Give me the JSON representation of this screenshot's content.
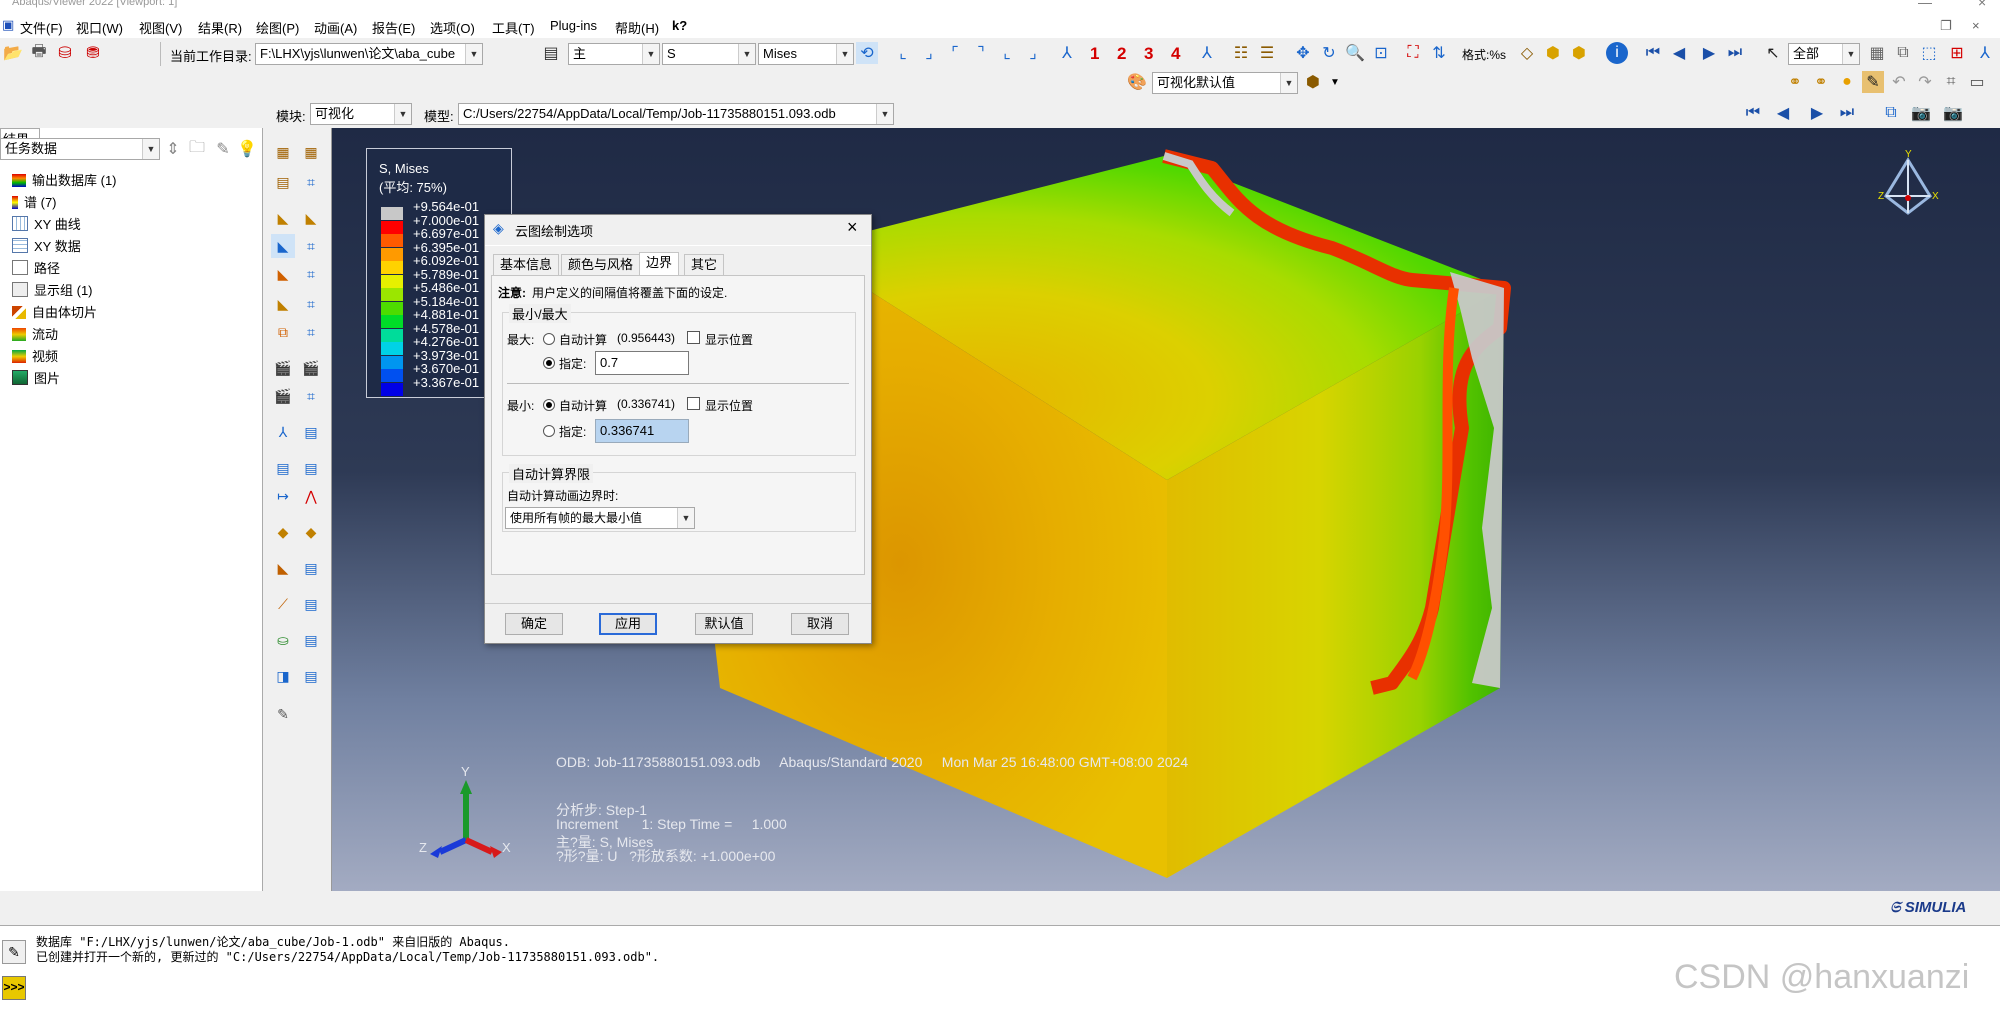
{
  "window": {
    "title": "Abaqus/Viewer 2022 [Viewport: 1]"
  },
  "menu": [
    "文件(F)",
    "视口(W)",
    "视图(V)",
    "结果(R)",
    "绘图(P)",
    "动画(A)",
    "报告(E)",
    "选项(O)",
    "工具(T)",
    "Plug-ins",
    "帮助(H)",
    "k?"
  ],
  "toolbar": {
    "workdir_label": "当前工作目录:",
    "workdir_value": "F:\\LHX\\yjs\\lunwen\\论文\\aba_cube",
    "combo_primary": "主",
    "combo_variable": "S",
    "combo_invariant": "Mises",
    "frame_numbers": [
      "1",
      "2",
      "3",
      "4"
    ],
    "format_label": "格式:%s",
    "selection_combo": "全部",
    "viz_default": "可视化默认值"
  },
  "context": {
    "module_label": "模块:",
    "module_value": "可视化",
    "model_label": "模型:",
    "model_value": "C:/Users/22754/AppData/Local/Temp/Job-11735880151.093.odb"
  },
  "left_panel": {
    "tab": "结果",
    "filter": "任务数据",
    "tree": [
      {
        "label": "输出数据库 (1)",
        "icon": "odb-icon"
      },
      {
        "label": "谱 (7)",
        "icon": "spectrum-icon"
      },
      {
        "label": "XY 曲线",
        "icon": "xy-curve-icon"
      },
      {
        "label": "XY 数据",
        "icon": "xy-data-icon"
      },
      {
        "label": "路径",
        "icon": "path-icon"
      },
      {
        "label": "显示组 (1)",
        "icon": "display-group-icon"
      },
      {
        "label": "自由体切片",
        "icon": "free-body-icon"
      },
      {
        "label": "流动",
        "icon": "flow-icon"
      },
      {
        "label": "视频",
        "icon": "movie-icon"
      },
      {
        "label": "图片",
        "icon": "image-icon"
      }
    ]
  },
  "legend": {
    "title": "S, Mises",
    "subtitle": "(平均: 75%)",
    "values": [
      "+9.564e-01",
      "+7.000e-01",
      "+6.697e-01",
      "+6.395e-01",
      "+6.092e-01",
      "+5.789e-01",
      "+5.486e-01",
      "+5.184e-01",
      "+4.881e-01",
      "+4.578e-01",
      "+4.276e-01",
      "+3.973e-01",
      "+3.670e-01",
      "+3.367e-01"
    ],
    "colors": [
      "#c8c8c8",
      "#ff0000",
      "#ff5a00",
      "#ff9a00",
      "#ffd200",
      "#e6f000",
      "#9be600",
      "#4ddc00",
      "#00dc28",
      "#00dc9a",
      "#00d2e6",
      "#0096f0",
      "#0050f0",
      "#0000e6"
    ]
  },
  "dialog": {
    "title": "云图绘制选项",
    "tabs": [
      "基本信息",
      "颜色与风格",
      "边界",
      "其它"
    ],
    "active_tab": "边界",
    "note_bold": "注意:",
    "note_text": "用户定义的间隔值将覆盖下面的设定.",
    "minmax_group": "最小/最大",
    "max_label": "最大:",
    "max_auto_label": "自动计算",
    "max_auto_value": "(0.956443)",
    "max_show_pos": "显示位置",
    "max_spec_label": "指定:",
    "max_spec_value": "0.7",
    "min_label": "最小:",
    "min_auto_label": "自动计算",
    "min_auto_value": "(0.336741)",
    "min_show_pos": "显示位置",
    "min_spec_label": "指定:",
    "min_spec_value": "0.336741",
    "auto_group": "自动计算界限",
    "auto_anim_label": "自动计算动画边界时:",
    "auto_anim_value": "使用所有帧的最大最小值",
    "buttons": {
      "ok": "确定",
      "apply": "应用",
      "defaults": "默认值",
      "cancel": "取消"
    }
  },
  "viewport_info": {
    "odb_line": "ODB: Job-11735880151.093.odb     Abaqus/Standard 2020     Mon Mar 25 16:48:00 GMT+08:00 2024",
    "step_line": "分析步: Step-1",
    "increment_line": "Increment      1: Step Time =     1.000",
    "primary_line": "主?量: S, Mises",
    "deformed_line": "?形?量: U   ?形放系数: +1.000e+00",
    "triad": {
      "y": "Y",
      "z": "Z",
      "x": "X"
    },
    "brand": "SIMULIA"
  },
  "console": {
    "lines": [
      "数据库 \"F:/LHX/yjs/lunwen/论文/aba_cube/Job-1.odb\" 来自旧版的 Abaqus.",
      "已创建并打开一个新的, 更新过的 \"C:/Users/22754/AppData/Local/Temp/Job-11735880151.093.odb\"."
    ]
  },
  "watermark": "CSDN @hanxuanzi"
}
